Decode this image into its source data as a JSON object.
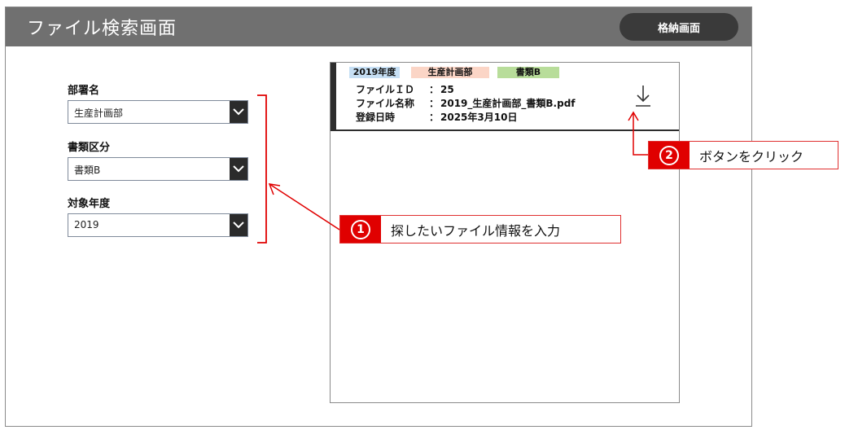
{
  "header": {
    "title": "ファイル検索画面",
    "store_button": "格納画面"
  },
  "filters": {
    "department": {
      "label": "部署名",
      "value": "生産計画部"
    },
    "doc_type": {
      "label": "書類区分",
      "value": "書類B"
    },
    "year": {
      "label": "対象年度",
      "value": "2019"
    }
  },
  "result": {
    "tags": {
      "year": "2019年度",
      "department": "生産計画部",
      "doc_type": "書類B"
    },
    "rows": [
      {
        "key": "ファイルＩＤ",
        "sep": "：",
        "value": "25"
      },
      {
        "key": "ファイル名称",
        "sep": "：",
        "value": "2019_生産計画部_書類B.pdf"
      },
      {
        "key": "登録日時",
        "sep": "：",
        "value": "2025年3月10日"
      }
    ]
  },
  "annotations": {
    "step1": {
      "number": "1",
      "text": "探したいファイル情報を入力"
    },
    "step2": {
      "number": "2",
      "text": "ボタンをクリック"
    }
  },
  "colors": {
    "header_bg": "#707070",
    "accent_red": "#e00000",
    "tag_year": "#c6dff4",
    "tag_department": "#fbd5c6",
    "tag_doc_type": "#b8dd9a"
  }
}
